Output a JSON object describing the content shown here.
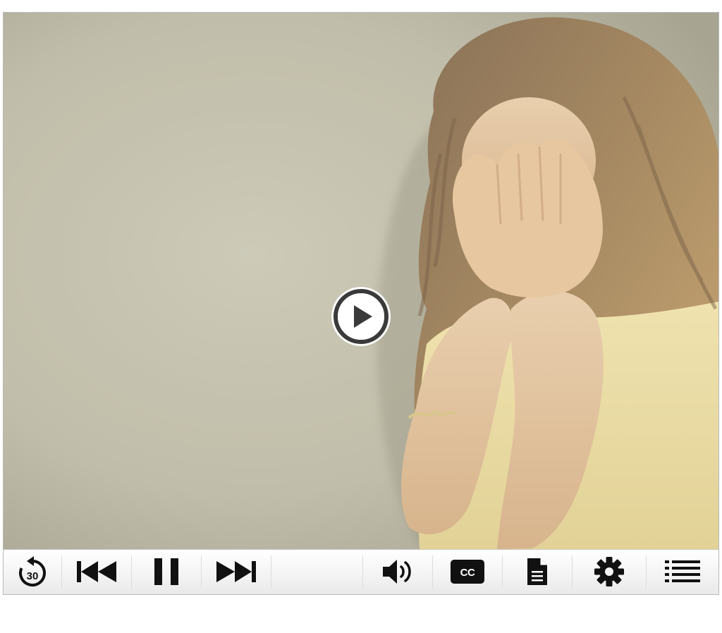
{
  "player": {
    "video": {
      "description_icon": "video-frame",
      "center_button_icon": "play-icon"
    },
    "controls": {
      "replay": {
        "icon": "replay-30-icon",
        "text": "30"
      },
      "previous": {
        "icon": "skip-back-icon"
      },
      "pause": {
        "icon": "pause-icon"
      },
      "next": {
        "icon": "skip-forward-icon"
      },
      "volume": {
        "icon": "volume-icon"
      },
      "captions": {
        "icon": "closed-captions-icon",
        "text": "CC"
      },
      "transcript": {
        "icon": "document-icon"
      },
      "settings": {
        "icon": "gear-icon"
      },
      "menu": {
        "icon": "list-icon"
      }
    },
    "colors": {
      "icon": "#111111",
      "control_bar_top": "#ffffff",
      "control_bar_bottom": "#e9e9e9",
      "play_ring": "#3a3a3a"
    }
  }
}
